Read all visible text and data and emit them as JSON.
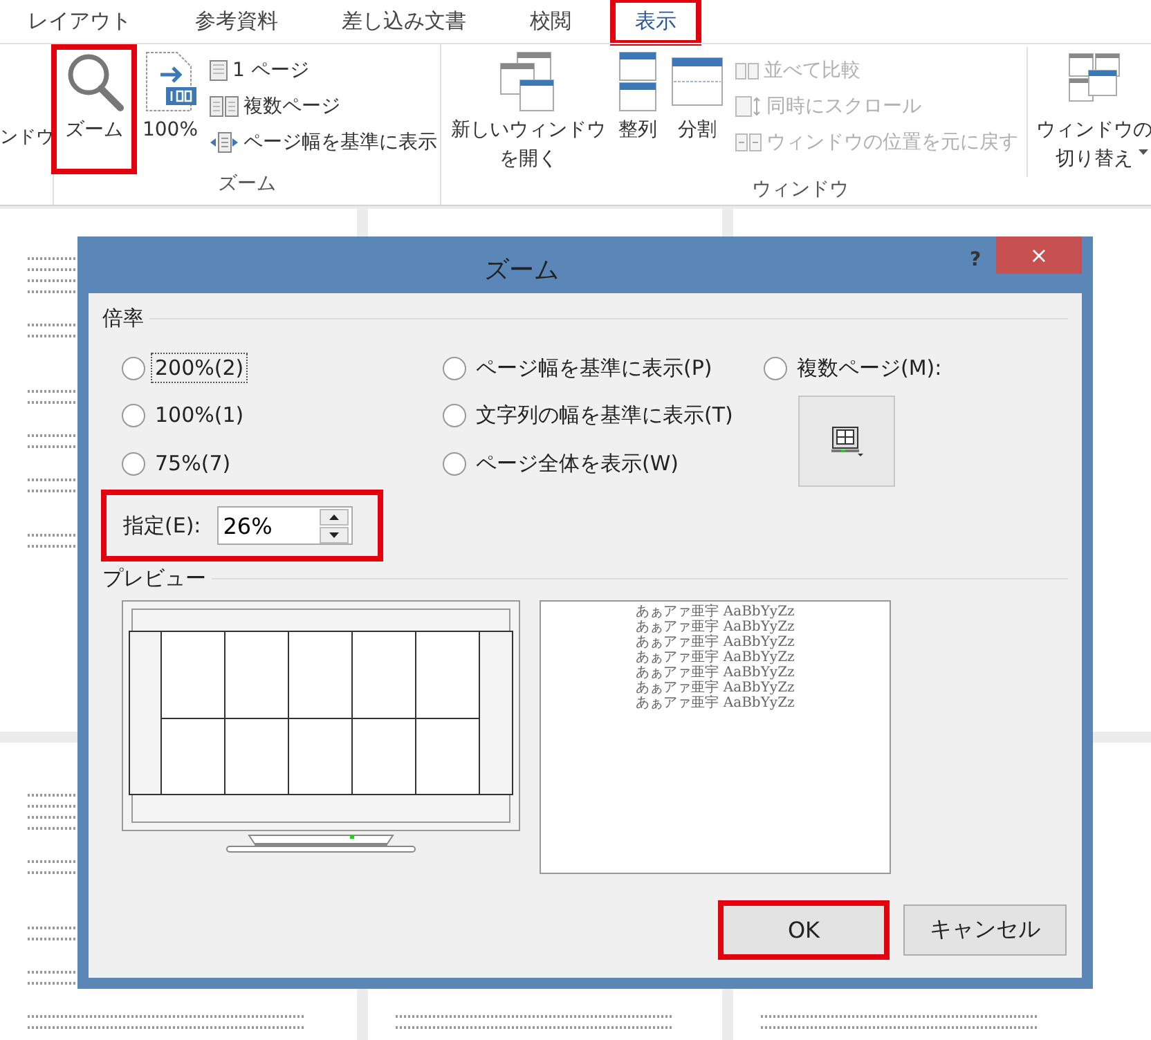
{
  "tabs": [
    {
      "label": "レイアウト",
      "selected": false,
      "highlighted": false
    },
    {
      "label": "参考資料",
      "selected": false,
      "highlighted": false
    },
    {
      "label": "差し込み文書",
      "selected": false,
      "highlighted": false
    },
    {
      "label": "校閲",
      "selected": false,
      "highlighted": false
    },
    {
      "label": "表示",
      "selected": true,
      "highlighted": true
    }
  ],
  "ribbon": {
    "cut_group_label": "ンドウ",
    "groups": [
      {
        "label": "ズーム",
        "items": [
          {
            "kind": "large",
            "label": "ズーム",
            "highlighted": true
          },
          {
            "kind": "large",
            "label": "100%",
            "highlighted": false
          },
          {
            "kind": "stack",
            "items": [
              {
                "label": "1 ページ",
                "disabled": false
              },
              {
                "label": "複数ページ",
                "disabled": false
              },
              {
                "label": "ページ幅を基準に表示",
                "disabled": false
              }
            ]
          }
        ]
      },
      {
        "label": "ウィンドウ",
        "items": [
          {
            "kind": "large",
            "label": "新しいウィンドウを開く",
            "highlighted": false
          },
          {
            "kind": "large",
            "label": "整列",
            "highlighted": false
          },
          {
            "kind": "large",
            "label": "分割",
            "highlighted": false
          },
          {
            "kind": "stack",
            "items": [
              {
                "label": "並べて比較",
                "disabled": true
              },
              {
                "label": "同時にスクロール",
                "disabled": true
              },
              {
                "label": "ウィンドウの位置を元に戻す",
                "disabled": true
              }
            ]
          },
          {
            "kind": "dropdown",
            "label": "ウィンドウの切り替え",
            "highlighted": false
          }
        ]
      }
    ]
  },
  "dialog": {
    "title": "ズーム",
    "help": "?",
    "close": "×",
    "zoom_section": {
      "label": "倍率",
      "options": [
        {
          "label": "200%(2)",
          "selected": false,
          "focused": true
        },
        {
          "label": "ページ幅を基準に表示(P)",
          "selected": false,
          "focused": false
        },
        {
          "label": "複数ページ(M):",
          "selected": false,
          "focused": false
        },
        {
          "label": "100%(1)",
          "selected": false,
          "focused": false
        },
        {
          "label": "文字列の幅を基準に表示(T)",
          "selected": false,
          "focused": false
        },
        {
          "label": "75%(7)",
          "selected": false,
          "focused": false
        },
        {
          "label": "ページ全体を表示(W)",
          "selected": false,
          "focused": false
        }
      ],
      "custom": {
        "label": "指定(E):",
        "value": "26%",
        "highlighted": true
      }
    },
    "preview_section": {
      "label": "プレビュー",
      "sample_lines": [
        "あぁアァ亜宇 AaBbYyZz",
        "あぁアァ亜宇 AaBbYyZz",
        "あぁアァ亜宇 AaBbYyZz",
        "あぁアァ亜宇 AaBbYyZz",
        "あぁアァ亜宇 AaBbYyZz",
        "あぁアァ亜宇 AaBbYyZz",
        "あぁアァ亜宇 AaBbYyZz"
      ]
    },
    "buttons": [
      {
        "label": "OK",
        "highlighted": true
      },
      {
        "label": "キャンセル",
        "highlighted": false
      }
    ]
  }
}
